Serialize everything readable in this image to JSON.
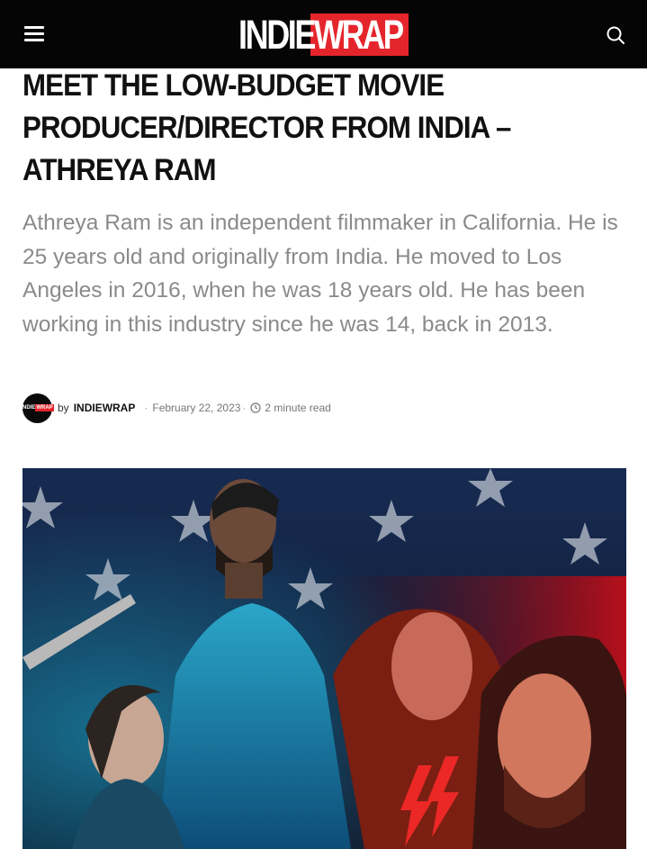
{
  "header": {
    "logo_part1": "INDIE",
    "logo_part2": "WRAP",
    "brand_color": "#e5252c",
    "menu_icon": "hamburger-menu-icon",
    "search_icon": "search-icon"
  },
  "article": {
    "title": "Meet the Low-Budget Movie Producer/Director from India – Athreya Ram",
    "excerpt": "Athreya Ram is an independent filmmaker in California. He is 25 years old and originally from India. He moved to Los Angeles in 2016, when he was 18 years old. He has been working in this industry since he was 14, back in 2013.",
    "meta": {
      "avatar_text_part1": "INDIE",
      "avatar_text_part2": "WRAP",
      "by_label": "by",
      "author": "INDIEWRAP",
      "date": "February 22, 2023",
      "read_time": "2 minute read",
      "separator": "·"
    },
    "featured_image": {
      "alt": "Film poster with characters in front of a starry flag"
    }
  }
}
